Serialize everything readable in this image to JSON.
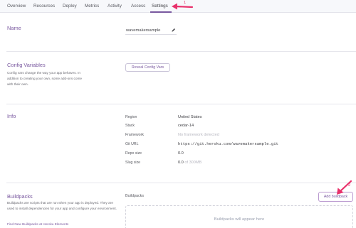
{
  "tabs": [
    "Overview",
    "Resources",
    "Deploy",
    "Metrics",
    "Activity",
    "Access",
    "Settings"
  ],
  "name_section": {
    "title": "Name",
    "app_name": "wavemakersample"
  },
  "config_section": {
    "title": "Config Variables",
    "description": "Config vars change the way your app behaves. In addition to creating your own, some add-ons come with their own.",
    "button": "Reveal Config Vars"
  },
  "info_section": {
    "title": "Info",
    "rows": [
      {
        "label": "Region",
        "value": "United States"
      },
      {
        "label": "Stack",
        "value": "cedar-14"
      },
      {
        "label": "Framework",
        "value": "No framework detected"
      },
      {
        "label": "Git URL",
        "value": "https://git.heroku.com/wavemakersample.git"
      },
      {
        "label": "Repo size",
        "value": "0.0"
      },
      {
        "label": "Slug size",
        "value": "0.0",
        "suffix": "of 300MB"
      }
    ]
  },
  "buildpacks_section": {
    "title": "Buildpacks",
    "description": "Buildpacks are scripts that are run when your app is deployed. They are used to install dependencies for your app and configure your environment.",
    "link": "Find New Buildpacks at Heroku Elements",
    "subheading": "Buildpacks",
    "button": "Add buildpack",
    "empty_text": "Buildpacks will appear here"
  },
  "annotations": {
    "step1": "1",
    "step2": "2"
  },
  "colors": {
    "accent": "#79589f",
    "annotation": "#e8316b"
  }
}
